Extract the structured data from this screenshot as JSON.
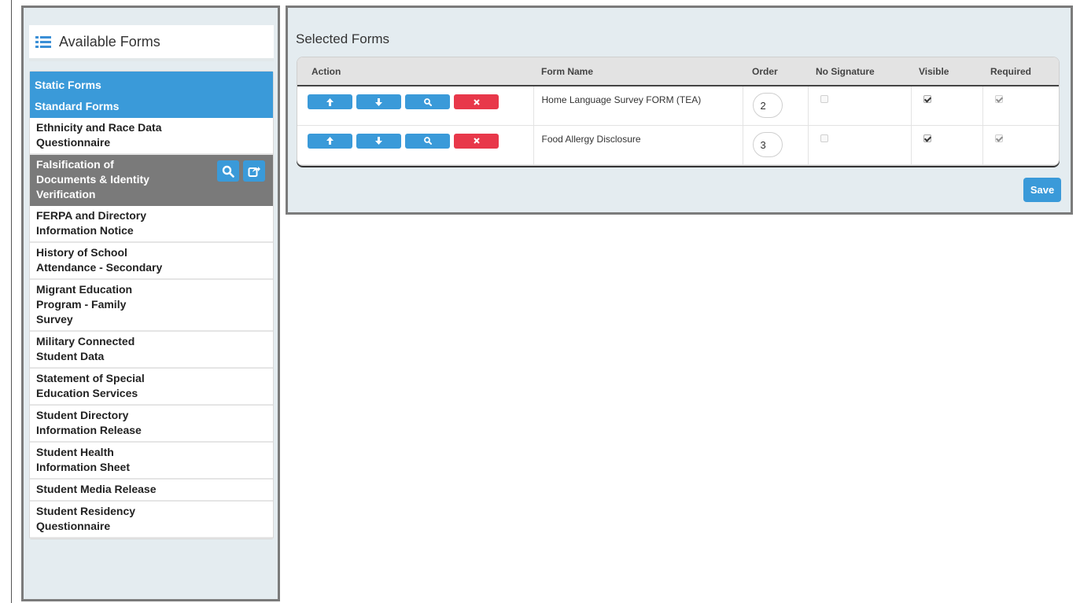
{
  "available_forms": {
    "title": "Available Forms",
    "categories": {
      "static": "Static Forms",
      "standard": "Standard Forms"
    },
    "items": [
      {
        "label": "Ethnicity and Race Data\nQuestionnaire"
      },
      {
        "label": "Falsification of\nDocuments & Identity\nVerification",
        "selected": true
      },
      {
        "label": "FERPA and Directory\nInformation Notice"
      },
      {
        "label": "History of School\nAttendance - Secondary"
      },
      {
        "label": "Migrant Education\nProgram - Family\nSurvey"
      },
      {
        "label": "Military Connected\nStudent Data"
      },
      {
        "label": "Statement of Special\nEducation Services"
      },
      {
        "label": "Student Directory\nInformation Release"
      },
      {
        "label": "Student Health\nInformation Sheet"
      },
      {
        "label": "Student Media Release"
      },
      {
        "label": "Student Residency\nQuestionnaire"
      }
    ],
    "selected_actions": [
      "search-icon",
      "share-icon"
    ]
  },
  "selected_forms": {
    "title": "Selected Forms",
    "columns": [
      "Action",
      "Form Name",
      "Order",
      "No Signature",
      "Visible",
      "Required"
    ],
    "rows": [
      {
        "form_name": "Home Language Survey FORM (TEA)",
        "order": "2",
        "no_signature": false,
        "visible": true,
        "required": true
      },
      {
        "form_name": "Food Allergy Disclosure",
        "order": "3",
        "no_signature": false,
        "visible": true,
        "required": true
      }
    ],
    "save_label": "Save"
  },
  "colors": {
    "accent": "#3a9ad9",
    "danger": "#e8384a",
    "selected_item": "#7a7a7a",
    "panel_bg": "#e4ecf0"
  }
}
